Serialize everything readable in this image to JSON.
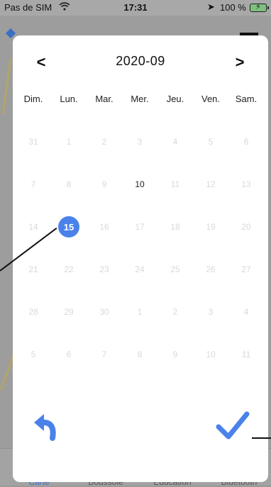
{
  "statusbar": {
    "carrier": "Pas de SIM",
    "time": "17:31",
    "battery": "100 %"
  },
  "datepicker": {
    "title": "2020-09",
    "prev_label": "<",
    "next_label": ">",
    "weekdays": [
      "Dim.",
      "Lun.",
      "Mar.",
      "Mer.",
      "Jeu.",
      "Ven.",
      "Sam."
    ],
    "weeks": [
      [
        "31",
        "1",
        "2",
        "3",
        "4",
        "5",
        "6"
      ],
      [
        "7",
        "8",
        "9",
        "10",
        "11",
        "12",
        "13"
      ],
      [
        "14",
        "15",
        "16",
        "17",
        "18",
        "19",
        "20"
      ],
      [
        "21",
        "22",
        "23",
        "24",
        "25",
        "26",
        "27"
      ],
      [
        "28",
        "29",
        "30",
        "1",
        "2",
        "3",
        "4"
      ],
      [
        "5",
        "6",
        "7",
        "8",
        "9",
        "10",
        "11"
      ]
    ],
    "enabled_day": "10",
    "selected_day": "15",
    "accent_color": "#4a82ea"
  },
  "tabbar": {
    "tabs": [
      {
        "label": "Carte",
        "icon": "map-icon"
      },
      {
        "label": "Boussole",
        "icon": "compass-icon"
      },
      {
        "label": "Éducation",
        "icon": "flag-icon"
      },
      {
        "label": "Bluetooth",
        "icon": "bluetooth-icon"
      }
    ]
  }
}
